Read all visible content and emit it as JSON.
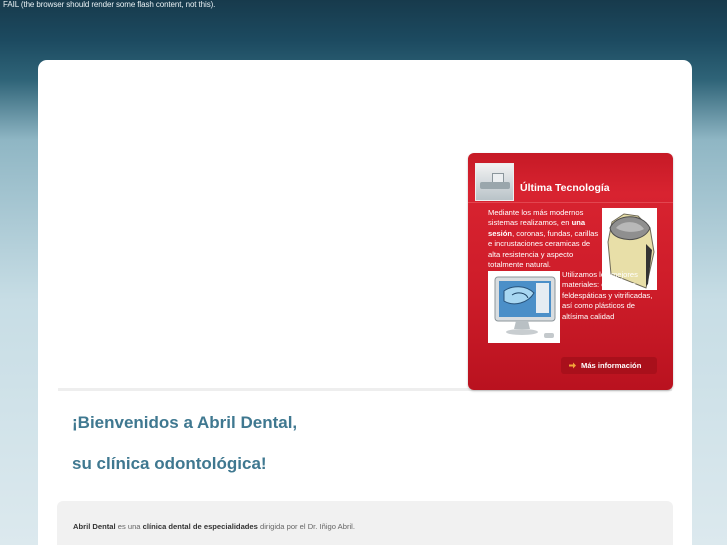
{
  "flash_fallback": "FAIL (the browser should render some flash content, not this).",
  "panel": {
    "title": "Última Tecnología",
    "text1_a": "Mediante los más modernos sistemas realizamos, en ",
    "text1_b": "una sesión",
    "text1_c": ", coronas, fundas, carillas e incrustaciones ceramicas de alta resistencia y aspecto totalmente natural.",
    "text2": "Utilizamos los mejores materiales: cerámicas feldespáticas y vitrificadas, así como plásticos de altísima calidad",
    "more_label": "Más información",
    "colors": {
      "panel_red": "#cd1c29",
      "button_red": "#a9101b",
      "arrow": "#f2a53a"
    }
  },
  "welcome": {
    "line1": "¡Bienvenidos a Abril Dental,",
    "line2": "su clínica odontológica!"
  },
  "info": {
    "brand": "Abril Dental",
    "text_a": " es una ",
    "highlight": "clínica dental de especialidades",
    "text_b": " dirigida por el Dr. Iñigo Abril."
  },
  "icons": {
    "more_arrow": "arrow-right-icon",
    "thumb": "dental-equipment-image",
    "tooth": "dental-crown-image",
    "screen": "cad-monitor-image"
  }
}
